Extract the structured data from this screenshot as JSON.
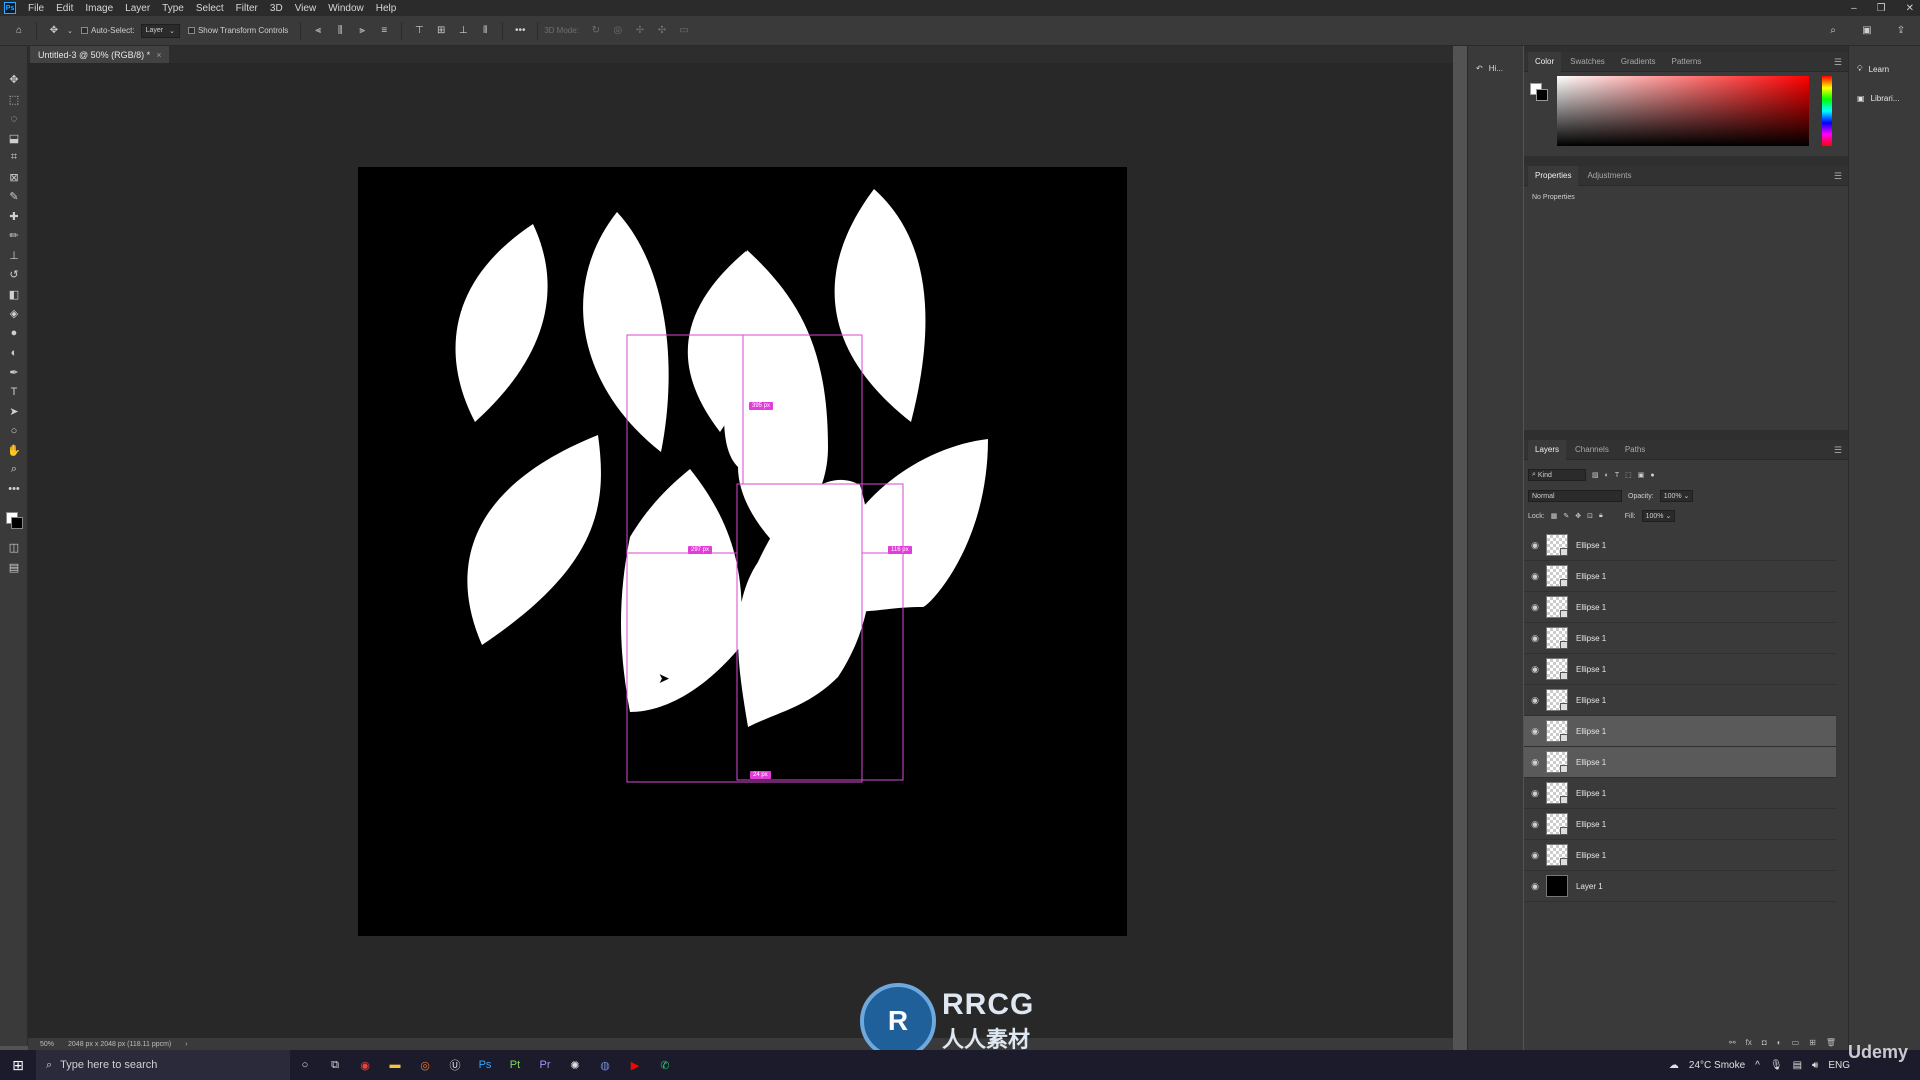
{
  "menubar": {
    "app_icon": "Ps",
    "items": [
      "File",
      "Edit",
      "Image",
      "Layer",
      "Type",
      "Select",
      "Filter",
      "3D",
      "View",
      "Window",
      "Help"
    ]
  },
  "options": {
    "auto_select_label": "Auto-Select:",
    "auto_select_value": "Layer",
    "show_transform_label": "Show Transform Controls",
    "mode_3d_label": "3D Mode:"
  },
  "document": {
    "tab_title": "Untitled-3 @ 50% (RGB/8) *",
    "tab_close": "×"
  },
  "measurements": {
    "top": "395 px",
    "left": "297 px",
    "right": "116 px",
    "bottom": "24 px"
  },
  "status": {
    "zoom": "50%",
    "doc_info": "2048 px x 2048 px (118.11 ppcm)",
    "arrow": "›"
  },
  "history": {
    "label": "Hi..."
  },
  "color_panel": {
    "tabs": [
      "Color",
      "Swatches",
      "Gradients",
      "Patterns"
    ],
    "active": 0,
    "foreground": "#ffffff",
    "background": "#000000",
    "hue": "#ff0000"
  },
  "properties_panel": {
    "tabs": [
      "Properties",
      "Adjustments"
    ],
    "active": 0,
    "empty_text": "No Properties"
  },
  "layers_panel": {
    "tabs": [
      "Layers",
      "Channels",
      "Paths"
    ],
    "active": 0,
    "filter_label": "Kind",
    "blend_mode": "Normal",
    "opacity_label": "Opacity:",
    "opacity_value": "100%",
    "lock_label": "Lock:",
    "fill_label": "Fill:",
    "fill_value": "100%",
    "layers": [
      {
        "name": "Ellipse 1",
        "selected": false,
        "black": false
      },
      {
        "name": "Ellipse 1",
        "selected": false,
        "black": false
      },
      {
        "name": "Ellipse 1",
        "selected": false,
        "black": false
      },
      {
        "name": "Ellipse 1",
        "selected": false,
        "black": false
      },
      {
        "name": "Ellipse 1",
        "selected": false,
        "black": false
      },
      {
        "name": "Ellipse 1",
        "selected": false,
        "black": false
      },
      {
        "name": "Ellipse 1",
        "selected": true,
        "black": false
      },
      {
        "name": "Ellipse 1",
        "selected": true,
        "black": false
      },
      {
        "name": "Ellipse 1",
        "selected": false,
        "black": false
      },
      {
        "name": "Ellipse 1",
        "selected": false,
        "black": false
      },
      {
        "name": "Ellipse 1",
        "selected": false,
        "black": false
      },
      {
        "name": "Layer 1",
        "selected": false,
        "black": true
      }
    ],
    "footer_icons": [
      "link-icon",
      "fx-icon",
      "mask-icon",
      "adjustment-icon",
      "group-icon",
      "new-layer-icon",
      "trash-icon"
    ]
  },
  "learn_strip": {
    "learn": "Learn",
    "libraries": "Librari..."
  },
  "watermark": {
    "logo": "RRCG",
    "sub": "人人素材"
  },
  "taskbar": {
    "search_placeholder": "Type here to search",
    "weather": "24°C  Smoke",
    "language": "ENG"
  },
  "udemy": "Udemy"
}
